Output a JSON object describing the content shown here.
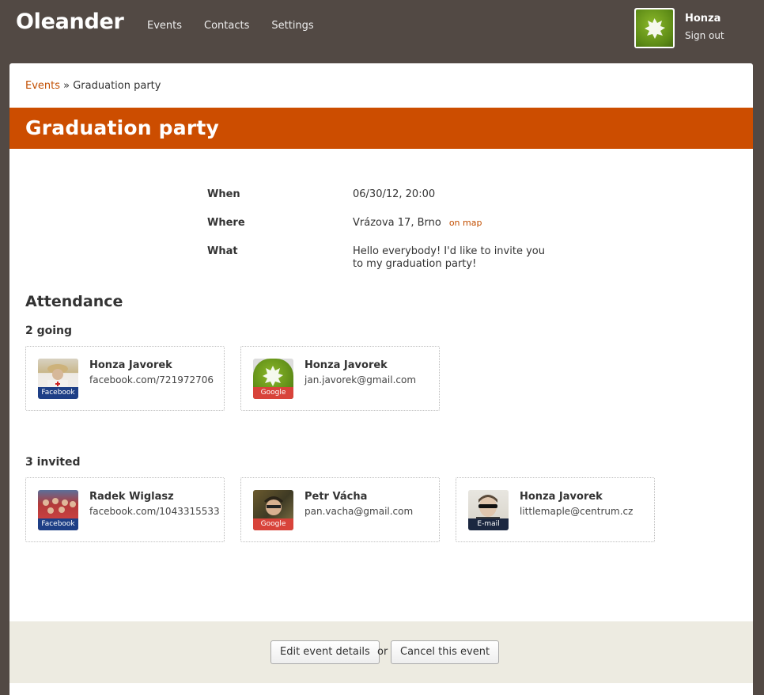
{
  "app": {
    "name": "Oleander"
  },
  "nav": {
    "items": [
      "Events",
      "Contacts",
      "Settings"
    ]
  },
  "user": {
    "name": "Honza",
    "signout": "Sign out"
  },
  "breadcrumb": {
    "link": "Events",
    "separator": " » ",
    "current": "Graduation party"
  },
  "event": {
    "title": "Graduation party",
    "when_label": "When",
    "when_value": "06/30/12, 20:00",
    "where_label": "Where",
    "where_value": "Vrázova 17, Brno",
    "map_link": "on map",
    "what_label": "What",
    "what_value": "Hello everybody! I'd like to invite you to my graduation party!"
  },
  "attendance": {
    "title": "Attendance",
    "going_title": "2 going",
    "going": [
      {
        "name": "Honza Javorek",
        "detail": "facebook.com/721972706",
        "source": "Facebook"
      },
      {
        "name": "Honza Javorek",
        "detail": "jan.javorek@gmail.com",
        "source": "Google"
      }
    ],
    "invited_title": "3 invited",
    "invited": [
      {
        "name": "Radek Wiglasz",
        "detail": "facebook.com/1043315533",
        "source": "Facebook"
      },
      {
        "name": "Petr Vácha",
        "detail": "pan.vacha@gmail.com",
        "source": "Google"
      },
      {
        "name": "Honza Javorek",
        "detail": "littlemaple@centrum.cz",
        "source": "E-mail"
      }
    ]
  },
  "footer": {
    "edit_label": "Edit event details",
    "or_label": "or",
    "cancel_label": "Cancel this event"
  },
  "colors": {
    "accent": "#cc4d00",
    "link": "#c24e00",
    "topbar": "#524944",
    "footer_bg": "#edebe1"
  }
}
